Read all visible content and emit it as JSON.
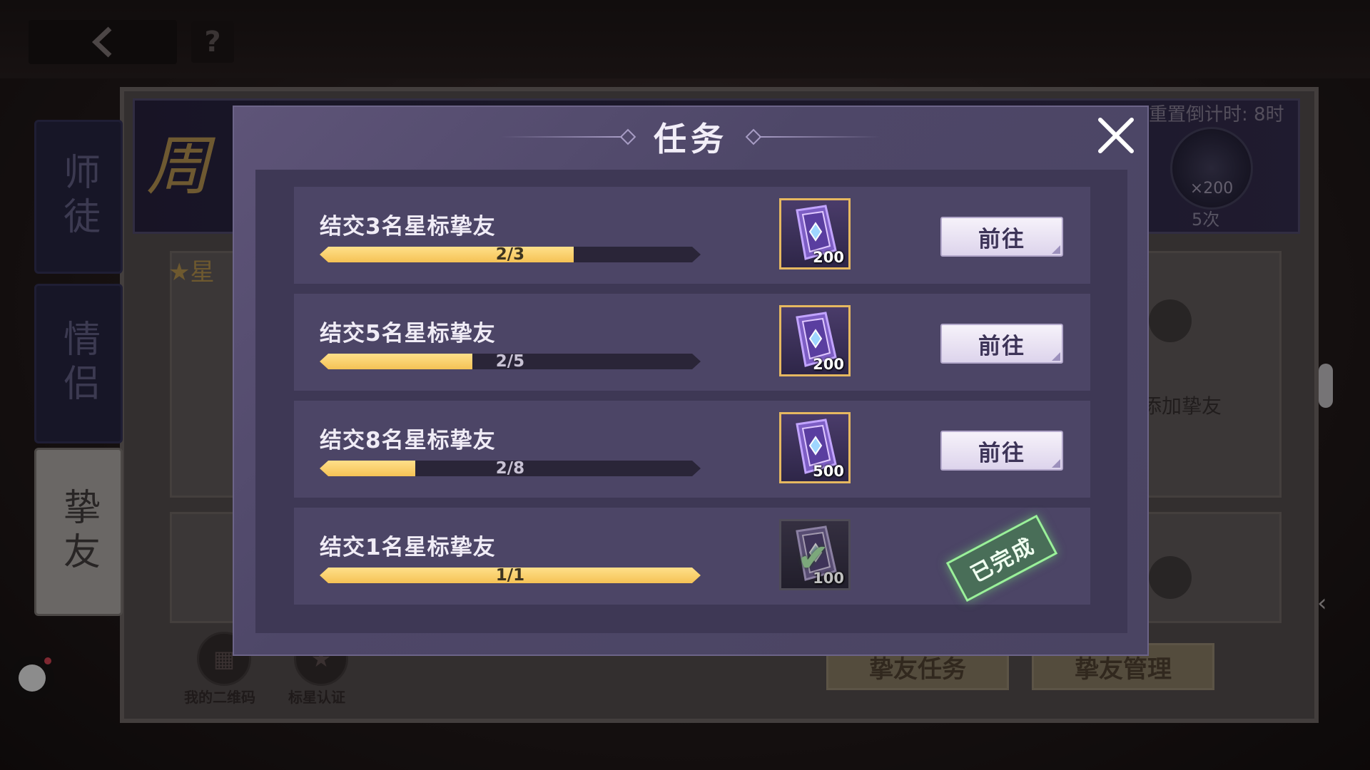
{
  "background": {
    "logo_char": "周",
    "reset_countdown": "重置倒计时: 8时",
    "gem_reward": "×200",
    "times": "5次",
    "side_tabs": [
      "师徒",
      "情侣",
      "挚友"
    ],
    "star_label": "星",
    "add_friend": "添加挚友",
    "qr_label": "我的二维码",
    "star_cert_label": "标星认证",
    "friend_task_btn": "挚友任务",
    "friend_manage_btn": "挚友管理",
    "help_symbol": "?"
  },
  "modal": {
    "title": "任务",
    "tasks": [
      {
        "title": "结交3名星标挚友",
        "progress_text": "2/3",
        "progress": 0.667,
        "reward_count": "200",
        "action": "前往",
        "completed": false
      },
      {
        "title": "结交5名星标挚友",
        "progress_text": "2/5",
        "progress": 0.4,
        "reward_count": "200",
        "action": "前往",
        "completed": false
      },
      {
        "title": "结交8名星标挚友",
        "progress_text": "2/8",
        "progress": 0.25,
        "reward_count": "500",
        "action": "前往",
        "completed": false
      },
      {
        "title": "结交1名星标挚友",
        "progress_text": "1/1",
        "progress": 1.0,
        "reward_count": "100",
        "status": "已完成",
        "completed": true
      }
    ]
  },
  "colors": {
    "accent_gold": "#f5c255",
    "modal_bg": "#4e4768",
    "completed_green": "#7cf07a"
  }
}
